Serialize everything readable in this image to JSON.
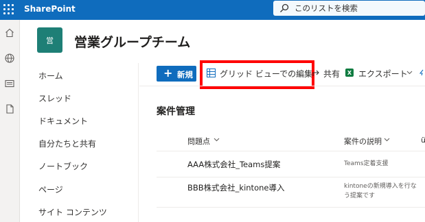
{
  "suite": {
    "app_name": "SharePoint",
    "search_placeholder": "このリストを検索",
    "brand_color": "#0f6cbd"
  },
  "rail": {
    "icons": [
      "home-icon",
      "globe-icon",
      "news-icon",
      "document-icon"
    ]
  },
  "site": {
    "logo_text": "営",
    "logo_color": "#1e7f76",
    "title": "営業グループチーム"
  },
  "nav": {
    "items": [
      {
        "label": "ホーム"
      },
      {
        "label": "スレッド"
      },
      {
        "label": "ドキュメント"
      },
      {
        "label": "自分たちと共有"
      },
      {
        "label": "ノートブック"
      },
      {
        "label": "ページ"
      },
      {
        "label": "サイト コンテンツ"
      }
    ]
  },
  "command_bar": {
    "new_label": "新規",
    "grid_edit_label": "グリッド ビューでの編集",
    "share_label": "共有",
    "export_label": "エクスポート",
    "highlight_color": "#ff0000"
  },
  "list": {
    "title": "案件管理",
    "columns": [
      {
        "label": "問題点"
      },
      {
        "label": "案件の説明"
      },
      {
        "label": "ü"
      }
    ],
    "rows": [
      {
        "title": "AAA株式会社_Teams提案",
        "description": "Teams定着支援"
      },
      {
        "title": "BBB株式会社_kintone導入",
        "description": "kintoneの新規導入を行なう提案です"
      }
    ]
  }
}
